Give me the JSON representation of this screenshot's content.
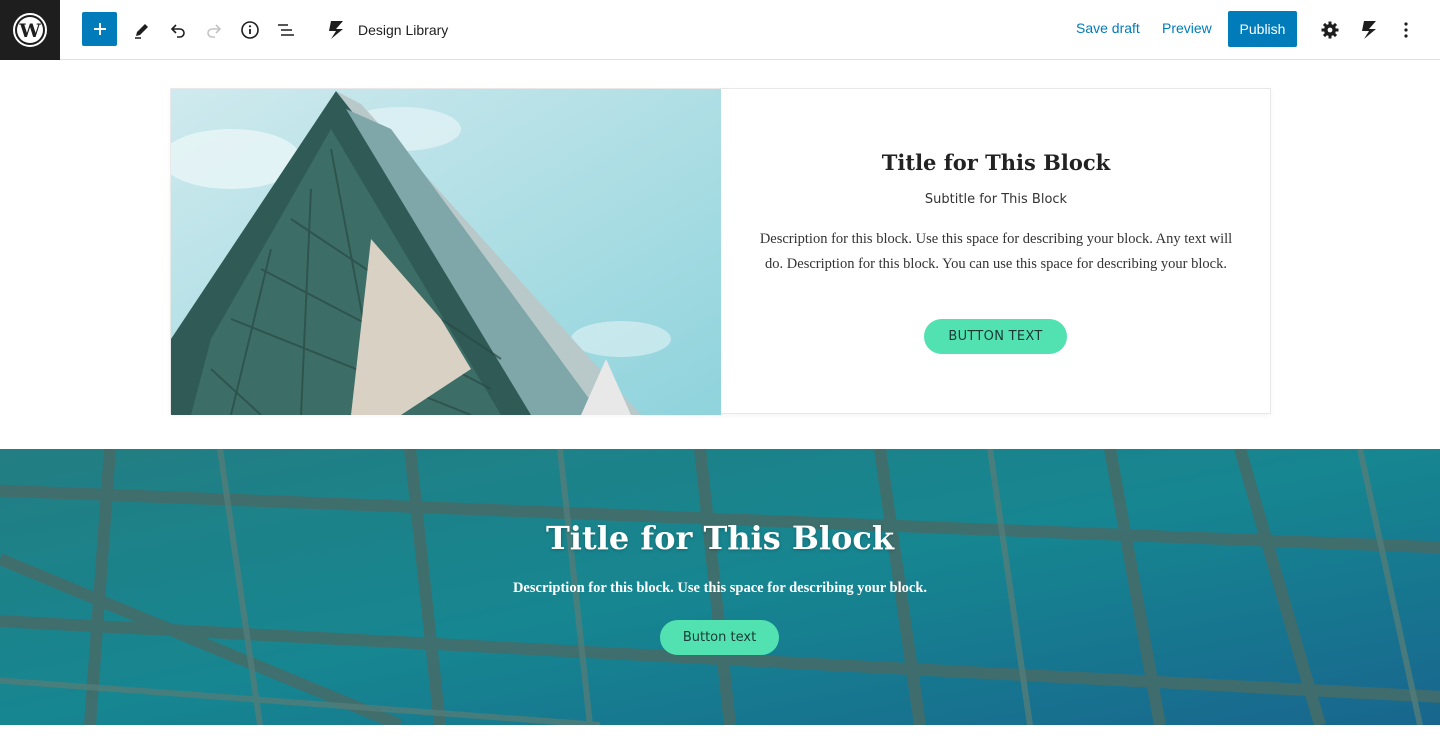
{
  "toolbar": {
    "logo_icon": "wordpress-logo-icon",
    "add_icon": "plus-icon",
    "tools_icon": "pencil-icon",
    "undo_icon": "undo-icon",
    "redo_icon": "redo-icon",
    "info_icon": "info-icon",
    "list_view_icon": "list-view-icon",
    "brand_icon": "stackable-icon",
    "brand_label": "Design Library",
    "save_draft_label": "Save draft",
    "preview_label": "Preview",
    "publish_label": "Publish",
    "settings_icon": "gear-icon",
    "stackable_icon": "stackable-icon",
    "options_icon": "more-vertical-icon"
  },
  "feature_block": {
    "image_icon": "building-image",
    "title": "Title for This Block",
    "subtitle": "Subtitle for This Block",
    "description": "Description for this block. Use this space for describing your block. Any text will do. Description for this block. You can use this space for describing your block.",
    "button_label": "BUTTON TEXT"
  },
  "hero_block": {
    "background_icon": "glass-building-background",
    "title": "Title for This Block",
    "description": "Description for this block. Use this space for describing your block.",
    "button_label": "Button text"
  },
  "colors": {
    "wp_blue": "#007cba",
    "button_accent": "#52e2b1",
    "toolbar_dark": "#1e1e1e"
  }
}
